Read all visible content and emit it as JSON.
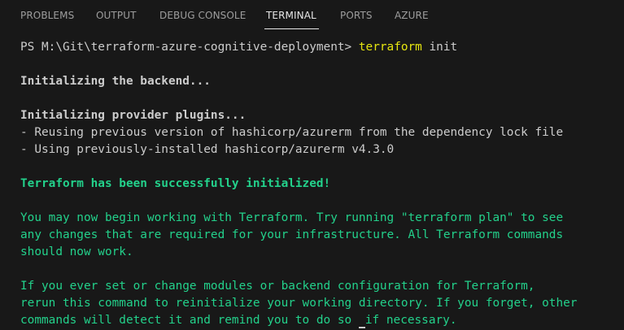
{
  "tabs": [
    {
      "label": "PROBLEMS"
    },
    {
      "label": "OUTPUT"
    },
    {
      "label": "DEBUG CONSOLE"
    },
    {
      "label": "TERMINAL"
    },
    {
      "label": "PORTS"
    },
    {
      "label": "AZURE"
    }
  ],
  "active_tab": "TERMINAL",
  "colors": {
    "background": "#181818",
    "text": "#cccccc",
    "command": "#e5e510",
    "success": "#23d18b"
  },
  "terminal": {
    "prompt": "PS M:\\Git\\terraform-azure-cognitive-deployment> ",
    "command_name": "terraform",
    "command_args": " init",
    "init_backend": "Initializing the backend...",
    "init_plugins": "Initializing provider plugins...",
    "reusing_line": "- Reusing previous version of hashicorp/azurerm from the dependency lock file",
    "using_line": "- Using previously-installed hashicorp/azurerm v4.3.0",
    "success_line": "Terraform has been successfully initialized!",
    "para1_line1": "You may now begin working with Terraform. Try running \"terraform plan\" to see",
    "para1_line2": "any changes that are required for your infrastructure. All Terraform commands",
    "para1_line3": "should now work.",
    "para2_line1": "If you ever set or change modules or backend configuration for Terraform,",
    "para2_line2": "rerun this command to reinitialize your working directory. If you forget, other",
    "para2_line3_a": "commands will detect it and remind you to do so ",
    "para2_line3_b": "if necessary."
  }
}
